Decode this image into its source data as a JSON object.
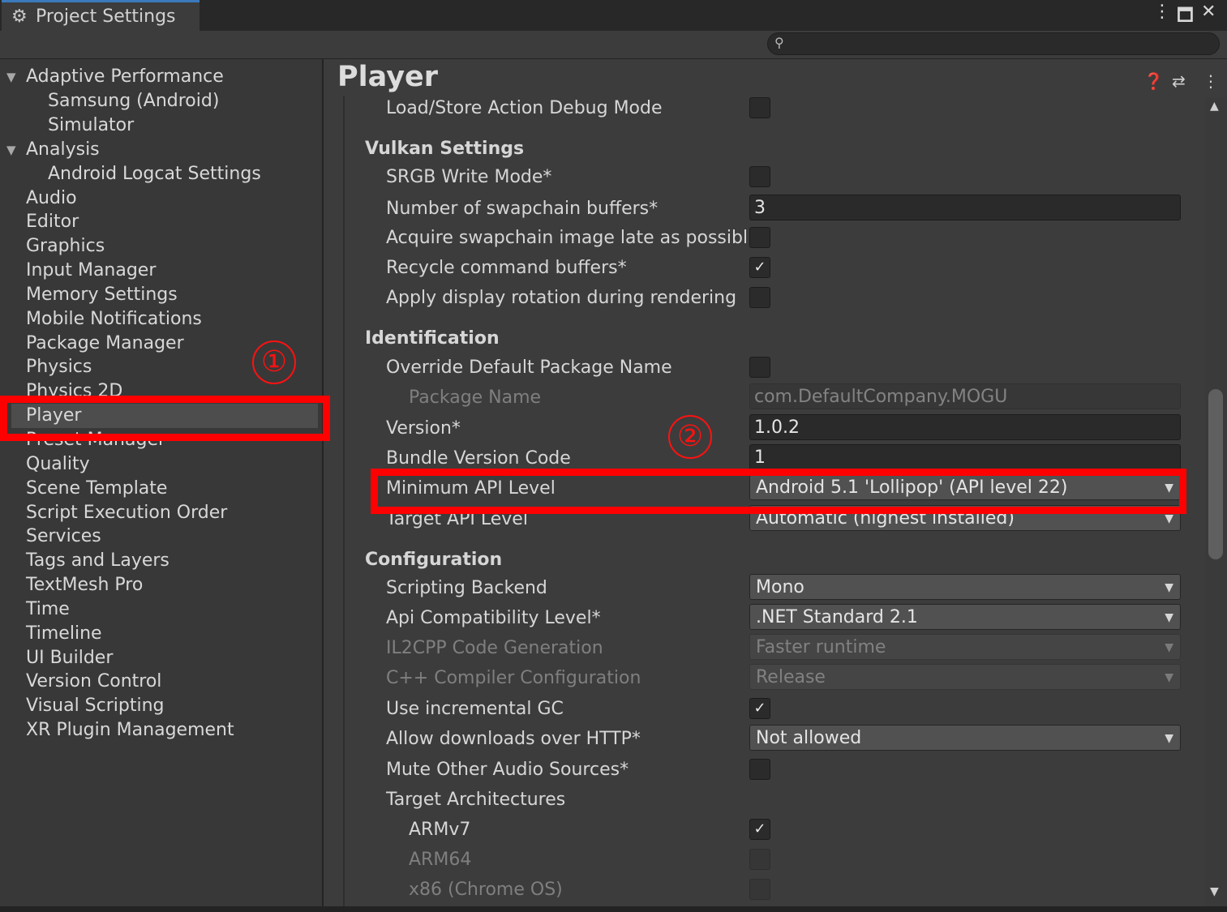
{
  "window": {
    "tab_title": "Project Settings",
    "tab_icon": "gear-icon",
    "controls": [
      "more-menu-icon",
      "maximize-icon",
      "close-icon"
    ]
  },
  "search": {
    "placeholder": "",
    "icon": "search-icon"
  },
  "sidebar": {
    "selected": "Player",
    "items": [
      {
        "label": "Adaptive Performance",
        "level": 0,
        "expanded": true
      },
      {
        "label": "Samsung (Android)",
        "level": 1
      },
      {
        "label": "Simulator",
        "level": 1
      },
      {
        "label": "Analysis",
        "level": 0,
        "expanded": true
      },
      {
        "label": "Android Logcat Settings",
        "level": 1
      },
      {
        "label": "Audio",
        "level": 0
      },
      {
        "label": "Editor",
        "level": 0
      },
      {
        "label": "Graphics",
        "level": 0
      },
      {
        "label": "Input Manager",
        "level": 0
      },
      {
        "label": "Memory Settings",
        "level": 0
      },
      {
        "label": "Mobile Notifications",
        "level": 0
      },
      {
        "label": "Package Manager",
        "level": 0
      },
      {
        "label": "Physics",
        "level": 0
      },
      {
        "label": "Physics 2D",
        "level": 0
      },
      {
        "label": "Player",
        "level": 0
      },
      {
        "label": "Preset Manager",
        "level": 0
      },
      {
        "label": "Quality",
        "level": 0
      },
      {
        "label": "Scene Template",
        "level": 0
      },
      {
        "label": "Script Execution Order",
        "level": 0
      },
      {
        "label": "Services",
        "level": 0
      },
      {
        "label": "Tags and Layers",
        "level": 0
      },
      {
        "label": "TextMesh Pro",
        "level": 0
      },
      {
        "label": "Time",
        "level": 0
      },
      {
        "label": "Timeline",
        "level": 0
      },
      {
        "label": "UI Builder",
        "level": 0
      },
      {
        "label": "Version Control",
        "level": 0
      },
      {
        "label": "Visual Scripting",
        "level": 0
      },
      {
        "label": "XR Plugin Management",
        "level": 0
      }
    ]
  },
  "main": {
    "title": "Player",
    "header_icons": [
      "help-icon",
      "preset-icon",
      "more-menu-icon"
    ],
    "rows": [
      {
        "label": "Load/Store Action Debug Mode",
        "type": "checkbox",
        "checked": false
      },
      {
        "label": "Vulkan Settings",
        "type": "header"
      },
      {
        "label": "SRGB Write Mode*",
        "type": "checkbox",
        "checked": false
      },
      {
        "label": "Number of swapchain buffers*",
        "type": "field",
        "value": "3"
      },
      {
        "label": "Acquire swapchain image late as possible*",
        "type": "checkbox",
        "checked": false
      },
      {
        "label": "Recycle command buffers*",
        "type": "checkbox",
        "checked": true
      },
      {
        "label": "Apply display rotation during rendering",
        "type": "checkbox",
        "checked": false
      },
      {
        "label": "Identification",
        "type": "header"
      },
      {
        "label": "Override Default Package Name",
        "type": "checkbox",
        "checked": false
      },
      {
        "label": "Package Name",
        "type": "field",
        "value": "com.DefaultCompany.MOGU",
        "disabled": true,
        "indent": 2
      },
      {
        "label": "Version*",
        "type": "field",
        "value": "1.0.2"
      },
      {
        "label": "Bundle Version Code",
        "type": "field",
        "value": "1"
      },
      {
        "label": "Minimum API Level",
        "type": "dropdown",
        "value": "Android 5.1 'Lollipop' (API level 22)"
      },
      {
        "label": "Target API Level",
        "type": "dropdown",
        "value": "Automatic (highest installed)"
      },
      {
        "label": "Configuration",
        "type": "header"
      },
      {
        "label": "Scripting Backend",
        "type": "dropdown",
        "value": "Mono"
      },
      {
        "label": "Api Compatibility Level*",
        "type": "dropdown",
        "value": ".NET Standard 2.1"
      },
      {
        "label": "IL2CPP Code Generation",
        "type": "dropdown",
        "value": "Faster runtime",
        "disabled": true
      },
      {
        "label": "C++ Compiler Configuration",
        "type": "dropdown",
        "value": "Release",
        "disabled": true
      },
      {
        "label": "Use incremental GC",
        "type": "checkbox",
        "checked": true
      },
      {
        "label": "Allow downloads over HTTP*",
        "type": "dropdown",
        "value": "Not allowed"
      },
      {
        "label": "Mute Other Audio Sources*",
        "type": "checkbox",
        "checked": false
      },
      {
        "label": "Target Architectures",
        "type": "label"
      },
      {
        "label": "ARMv7",
        "type": "checkbox",
        "checked": true,
        "indent": 2
      },
      {
        "label": "ARM64",
        "type": "checkbox",
        "checked": false,
        "disabled": true,
        "indent": 2
      },
      {
        "label": "x86 (Chrome OS)",
        "type": "checkbox",
        "checked": false,
        "disabled": true,
        "indent": 2
      }
    ]
  },
  "annotations": {
    "marker_1": "①",
    "marker_2": "②",
    "color": "#ff0000"
  },
  "glyphs": {
    "check": "✓",
    "dropdown_arrow": "▼",
    "expanded_arrow": "▼"
  }
}
